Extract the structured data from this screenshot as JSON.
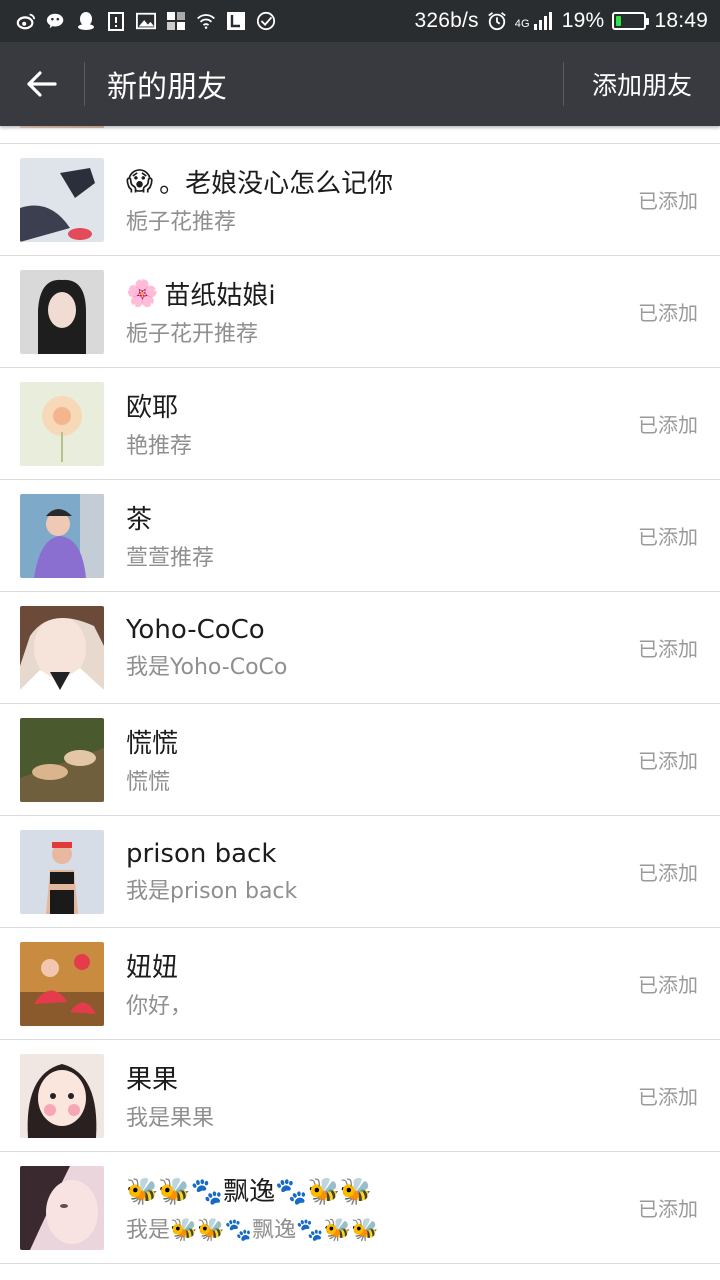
{
  "statusbar": {
    "speed": "326b/s",
    "network": "4G",
    "battery": "19%",
    "battery_level": 0.19,
    "time": "18:49",
    "icons": [
      "weibo-icon",
      "wechat-icon",
      "qq-icon",
      "clipboard-icon",
      "image-icon",
      "app-grid-icon",
      "wifi-icon",
      "app-l-icon",
      "check-circle-icon",
      "alarm-icon",
      "signal-icon",
      "battery-icon"
    ]
  },
  "appbar": {
    "title": "新的朋友",
    "add_friend": "添加朋友",
    "back_icon": "arrow-left-icon"
  },
  "friends": [
    {
      "name_prefix": "😱",
      "name": "。老娘没心怎么记你",
      "sub": "栀子花推荐",
      "status": "已添加"
    },
    {
      "name_prefix": "🌸",
      "name": " 苗纸姑娘i",
      "sub": "栀子花开推荐",
      "status": "已添加"
    },
    {
      "name_prefix": "",
      "name": "欧耶",
      "sub": "艳推荐",
      "status": "已添加"
    },
    {
      "name_prefix": "",
      "name": "茶",
      "sub": "萱萱推荐",
      "status": "已添加"
    },
    {
      "name_prefix": "",
      "name": "Yoho-CoCo",
      "sub": "我是Yoho-CoCo",
      "status": "已添加"
    },
    {
      "name_prefix": "",
      "name": "慌慌",
      "sub": "慌慌",
      "status": "已添加"
    },
    {
      "name_prefix": "",
      "name": "prison back",
      "sub": "我是prison back",
      "status": "已添加"
    },
    {
      "name_prefix": "",
      "name": "妞妞",
      "sub": "你好，",
      "status": "已添加"
    },
    {
      "name_prefix": "",
      "name": "果果",
      "sub": "我是果果",
      "status": "已添加"
    },
    {
      "name_prefix": "",
      "name": "🐝🐝🐾飘逸🐾🐝🐝",
      "sub": "我是🐝🐝🐾飘逸🐾🐝🐝",
      "status": "已添加"
    }
  ]
}
